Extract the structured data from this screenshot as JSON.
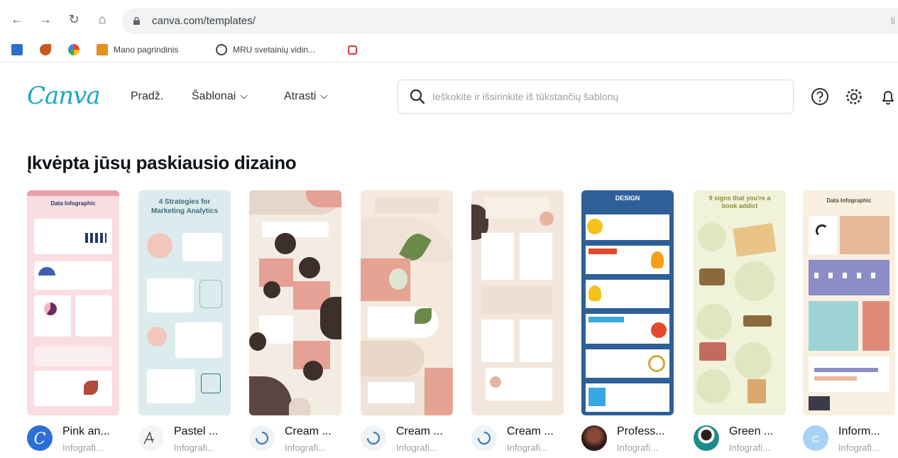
{
  "browser": {
    "url": "canva.com/templates/",
    "url_trailing": "li",
    "bookmarks": [
      "Mano pagrindinis",
      "MRU svetainių vidin..."
    ]
  },
  "header": {
    "logo": "Canva",
    "menu": [
      {
        "label": "Pradž."
      },
      {
        "label": "Šablonai"
      },
      {
        "label": "Atrasti"
      }
    ],
    "search_placeholder": "Ieškokite ir išsirinkite iš tūkstančių šablonų"
  },
  "section": {
    "title": "Įkvėpta jūsų paskiausio dizaino"
  },
  "templates": [
    {
      "title": "Pink an...",
      "subtitle": "Infografi...",
      "thumb_text": "Data Infographic",
      "colors": {
        "bg": "#f9dde0",
        "accent": "#e9a1ab",
        "dark": "#233a6b"
      }
    },
    {
      "title": "Pastel ...",
      "subtitle": "Infografi...",
      "thumb_text": "4 Strategies for Marketing Analytics",
      "colors": {
        "bg": "#dcecee",
        "accent": "#f1c7bd",
        "dark": "#3f6f78"
      }
    },
    {
      "title": "Cream ...",
      "subtitle": "Infografi...",
      "thumb_text": "",
      "colors": {
        "bg": "#f3ece3",
        "accent": "#e5a195",
        "dark": "#3c2f2c"
      }
    },
    {
      "title": "Cream ...",
      "subtitle": "Infografi...",
      "thumb_text": "",
      "colors": {
        "bg": "#f5e9dc",
        "accent": "#e6a293",
        "dark": "#6b8a4a"
      }
    },
    {
      "title": "Cream ...",
      "subtitle": "Infografi...",
      "thumb_text": "",
      "colors": {
        "bg": "#f3e7dd",
        "accent": "#e9b3a4",
        "dark": "#4a3a33"
      }
    },
    {
      "title": "Profess...",
      "subtitle": "Infografi...",
      "thumb_text": "DESIGN",
      "colors": {
        "bg": "#2f5f97",
        "accent": "#f4c21b",
        "dark": "#e6482c"
      }
    },
    {
      "title": "Green ...",
      "subtitle": "Infografi...",
      "thumb_text": "9 signs that you're a book addict",
      "colors": {
        "bg": "#f1f2da",
        "accent": "#c8d89f",
        "dark": "#8a6a3d"
      }
    },
    {
      "title": "Inform...",
      "subtitle": "Infografi...",
      "thumb_text": "Data Infographic",
      "colors": {
        "bg": "#f8efe0",
        "accent": "#e8b89a",
        "dark": "#5f5e9c"
      }
    }
  ]
}
